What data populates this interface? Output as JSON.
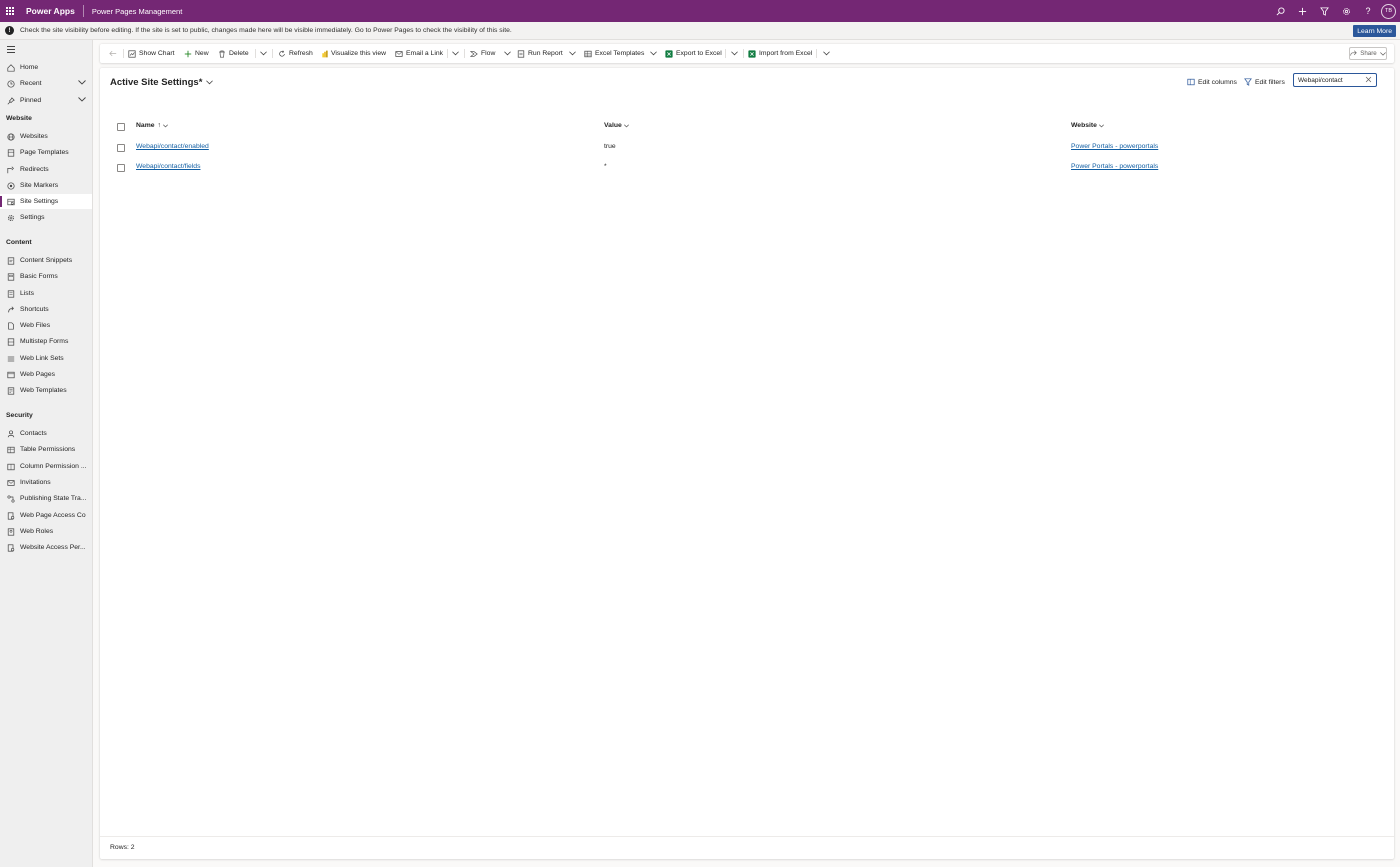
{
  "app": {
    "name": "Power Apps",
    "environment": "Power Pages Management",
    "avatar_initials": "TB"
  },
  "top_icons": [
    "search-icon",
    "plus-icon",
    "filter-icon",
    "gear-icon",
    "help-icon"
  ],
  "notification": {
    "text": "Check the site visibility before editing. If the site is set to public, changes made here will be visible immediately. Go to Power Pages to check the visibility of this site.",
    "button": "Learn More"
  },
  "sidebar": {
    "top_items": [
      {
        "label": "Home",
        "icon": "home-icon"
      },
      {
        "label": "Recent",
        "icon": "clock-icon",
        "expandable": true
      },
      {
        "label": "Pinned",
        "icon": "pin-icon",
        "expandable": true
      }
    ],
    "sections": [
      {
        "title": "Website",
        "items": [
          {
            "label": "Websites",
            "icon": "globe-icon"
          },
          {
            "label": "Page Templates",
            "icon": "page-template-icon"
          },
          {
            "label": "Redirects",
            "icon": "redirect-icon"
          },
          {
            "label": "Site Markers",
            "icon": "site-marker-icon"
          },
          {
            "label": "Site Settings",
            "icon": "site-settings-icon",
            "active": true
          },
          {
            "label": "Settings",
            "icon": "gear-icon"
          }
        ]
      },
      {
        "title": "Content",
        "items": [
          {
            "label": "Content Snippets",
            "icon": "snippet-icon"
          },
          {
            "label": "Basic Forms",
            "icon": "form-icon"
          },
          {
            "label": "Lists",
            "icon": "list-icon"
          },
          {
            "label": "Shortcuts",
            "icon": "shortcut-icon"
          },
          {
            "label": "Web Files",
            "icon": "file-icon"
          },
          {
            "label": "Multistep Forms",
            "icon": "multistep-form-icon"
          },
          {
            "label": "Web Link Sets",
            "icon": "link-set-icon"
          },
          {
            "label": "Web Pages",
            "icon": "web-page-icon"
          },
          {
            "label": "Web Templates",
            "icon": "web-template-icon"
          }
        ]
      },
      {
        "title": "Security",
        "items": [
          {
            "label": "Contacts",
            "icon": "person-icon"
          },
          {
            "label": "Table Permissions",
            "icon": "table-permission-icon"
          },
          {
            "label": "Column Permission ...",
            "icon": "column-permission-icon"
          },
          {
            "label": "Invitations",
            "icon": "invitation-icon"
          },
          {
            "label": "Publishing State Tra...",
            "icon": "publishing-icon"
          },
          {
            "label": "Web Page Access Co...",
            "icon": "access-icon"
          },
          {
            "label": "Web Roles",
            "icon": "role-icon"
          },
          {
            "label": "Website Access Per...",
            "icon": "website-access-icon"
          }
        ]
      }
    ]
  },
  "toolbar": {
    "back_icon": "back-arrow-icon",
    "buttons": [
      {
        "label": "Show Chart",
        "icon": "chart-icon"
      },
      {
        "label": "New",
        "icon": "plus-icon"
      },
      {
        "label": "Delete",
        "icon": "trash-icon"
      },
      {
        "label": "Refresh",
        "icon": "refresh-icon"
      },
      {
        "label": "Visualize this view",
        "icon": "powerbi-icon"
      },
      {
        "label": "Email a Link",
        "icon": "email-link-icon"
      },
      {
        "label": "Flow",
        "icon": "flow-icon"
      },
      {
        "label": "Run Report",
        "icon": "report-icon"
      },
      {
        "label": "Excel Templates",
        "icon": "excel-template-icon"
      },
      {
        "label": "Export to Excel",
        "icon": "excel-icon"
      },
      {
        "label": "Import from Excel",
        "icon": "excel-icon"
      }
    ],
    "share": "Share"
  },
  "view": {
    "title": "Active Site Settings*",
    "edit_columns": "Edit columns",
    "edit_filters": "Edit filters",
    "search_value": "Webapi/contact"
  },
  "grid": {
    "columns": [
      "Name",
      "Value",
      "Website"
    ],
    "sort_indicator": "↑",
    "rows": [
      {
        "name": "Webapi/contact/enabled",
        "value": "true",
        "website": "Power Portals - powerportals"
      },
      {
        "name": "Webapi/contact/fields",
        "value": "*",
        "website": "Power Portals - powerportals"
      }
    ]
  },
  "footer": {
    "rows_text": "Rows: 2"
  },
  "colors": {
    "brand": "#742774",
    "link": "#115ea3",
    "accent": "#2b579a"
  }
}
